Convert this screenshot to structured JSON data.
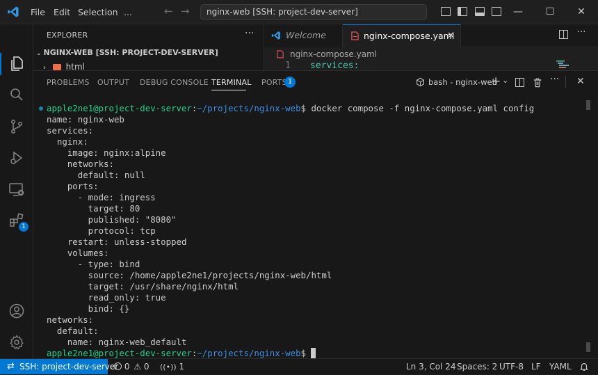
{
  "titlebar": {
    "menu": [
      "File",
      "Edit",
      "Selection",
      "..."
    ],
    "command_center": "nginx-web [SSH: project-dev-server]"
  },
  "sidebar": {
    "title": "EXPLORER",
    "more": "···",
    "folder": "NGINX-WEB [SSH: PROJECT-DEV-SERVER]",
    "item": "html"
  },
  "editor": {
    "tabs": [
      {
        "label": "Welcome",
        "active": false
      },
      {
        "label": "nginx-compose.yaml",
        "active": true
      }
    ],
    "breadcrumb": "nginx-compose.yaml",
    "line_number": "1",
    "line_text": "services:"
  },
  "panel": {
    "tabs": [
      "PROBLEMS",
      "OUTPUT",
      "DEBUG CONSOLE",
      "TERMINAL",
      "PORTS"
    ],
    "ports_count": "1",
    "terminal_name": "bash - nginx-web",
    "prompt": {
      "user": "apple2ne1@project-dev-server",
      "sep": ":",
      "path": "~/projects/nginx-web",
      "sign": "$"
    },
    "command": " docker compose -f nginx-compose.yaml config",
    "output": [
      "name: nginx-web",
      "services:",
      "  nginx:",
      "    image: nginx:alpine",
      "    networks:",
      "      default: null",
      "    ports:",
      "      - mode: ingress",
      "        target: 80",
      "        published: \"8080\"",
      "        protocol: tcp",
      "    restart: unless-stopped",
      "    volumes:",
      "      - type: bind",
      "        source: /home/apple2ne1/projects/nginx-web/html",
      "        target: /usr/share/nginx/html",
      "        read_only: true",
      "        bind: {}",
      "networks:",
      "  default:",
      "    name: nginx-web_default"
    ]
  },
  "activity": {
    "extensions_badge": "1"
  },
  "statusbar": {
    "remote": "SSH: project-dev-server",
    "errors": "0",
    "warnings": "0",
    "ports": "1",
    "position": "Ln 3, Col 24",
    "spaces": "Spaces: 2",
    "encoding": "UTF-8",
    "eol": "LF",
    "language": "YAML"
  },
  "colors": {
    "accent": "#0078d4",
    "prompt_user": "#23d18b",
    "prompt_path": "#3b8eea"
  }
}
